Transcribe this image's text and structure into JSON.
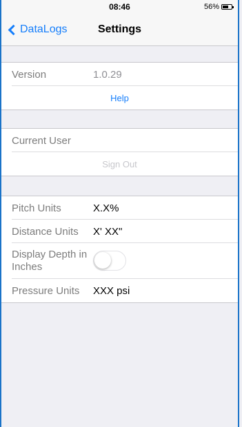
{
  "status_bar": {
    "time": "08:46",
    "battery": "56%"
  },
  "nav": {
    "back_label": "DataLogs",
    "title": "Settings"
  },
  "info": {
    "version_label": "Version",
    "version_value": "1.0.29",
    "help_label": "Help"
  },
  "user": {
    "current_user_label": "Current User",
    "sign_out_label": "Sign Out"
  },
  "units": {
    "pitch_label": "Pitch Units",
    "pitch_value": "X.X%",
    "distance_label": "Distance Units",
    "distance_value": "X' XX\"",
    "depth_label": "Display Depth in Inches",
    "depth_enabled": false,
    "pressure_label": "Pressure Units",
    "pressure_value": "XXX psi"
  },
  "colors": {
    "accent": "#157efb",
    "background": "#efeff4",
    "frame": "#1a73c8"
  }
}
